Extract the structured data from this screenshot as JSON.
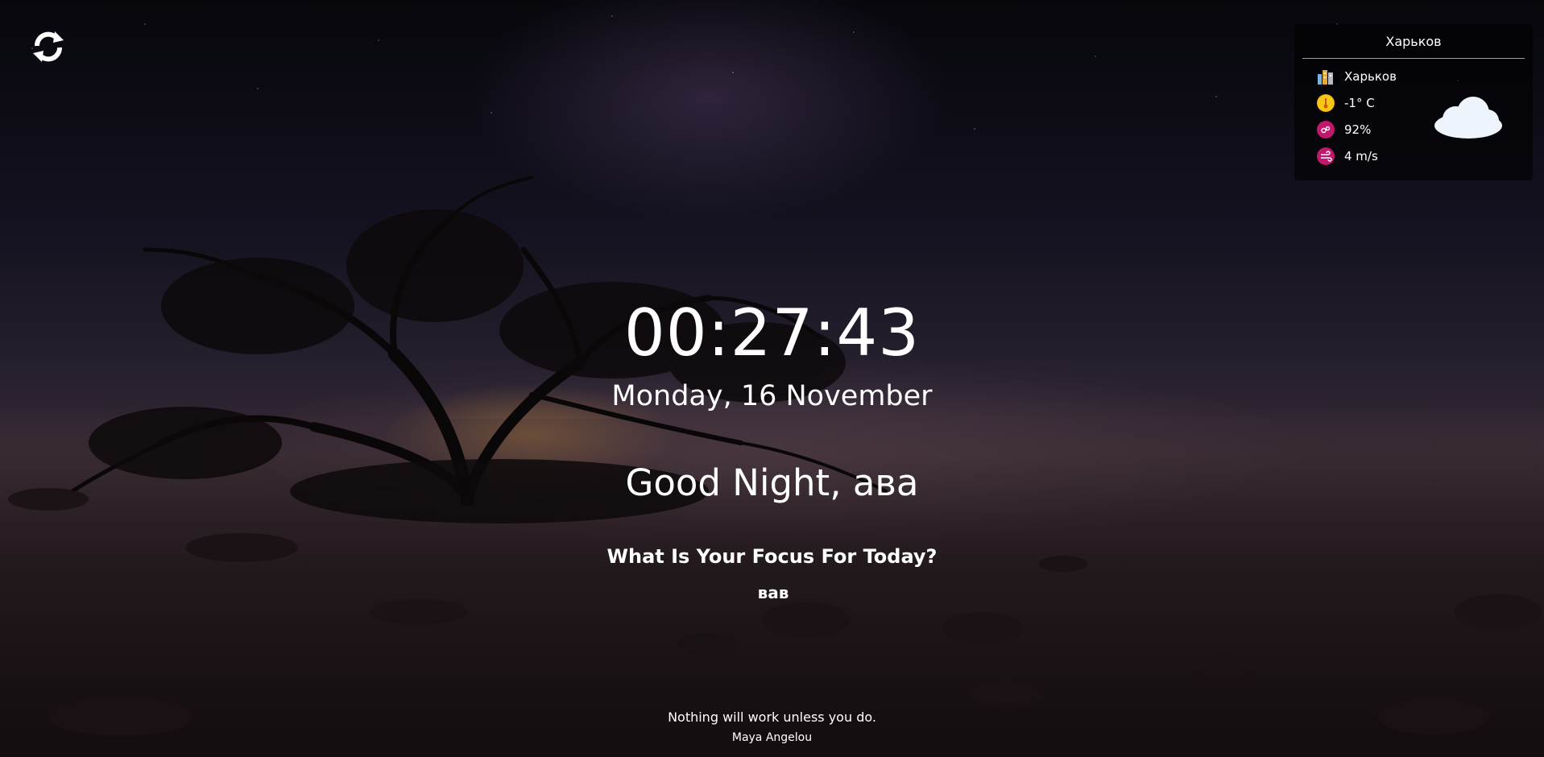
{
  "refresh": {
    "icon": "refresh-icon"
  },
  "weather": {
    "title": "Харьков",
    "city": "Харьков",
    "temperature": "-1° C",
    "humidity": "92%",
    "wind": "4 m/s",
    "icons": {
      "city": "city-icon",
      "temperature": "sun-temperature-icon",
      "humidity": "humidity-icon",
      "wind": "wind-icon",
      "condition": "cloud-icon"
    },
    "colors": {
      "temperature_badge": "#f2b705",
      "humidity_badge": "#c2186b",
      "wind_badge": "#c2186b",
      "cloud": "#eef4fb"
    }
  },
  "clock": {
    "time": "00:27:43"
  },
  "date": {
    "text": "Monday, 16 November"
  },
  "greeting": {
    "prefix": "Good Night, ",
    "name": "ава"
  },
  "focus": {
    "question": "What Is Your Focus For Today?",
    "value": "вав"
  },
  "quote": {
    "text": "Nothing will work unless you do.",
    "author": "Maya Angelou"
  }
}
